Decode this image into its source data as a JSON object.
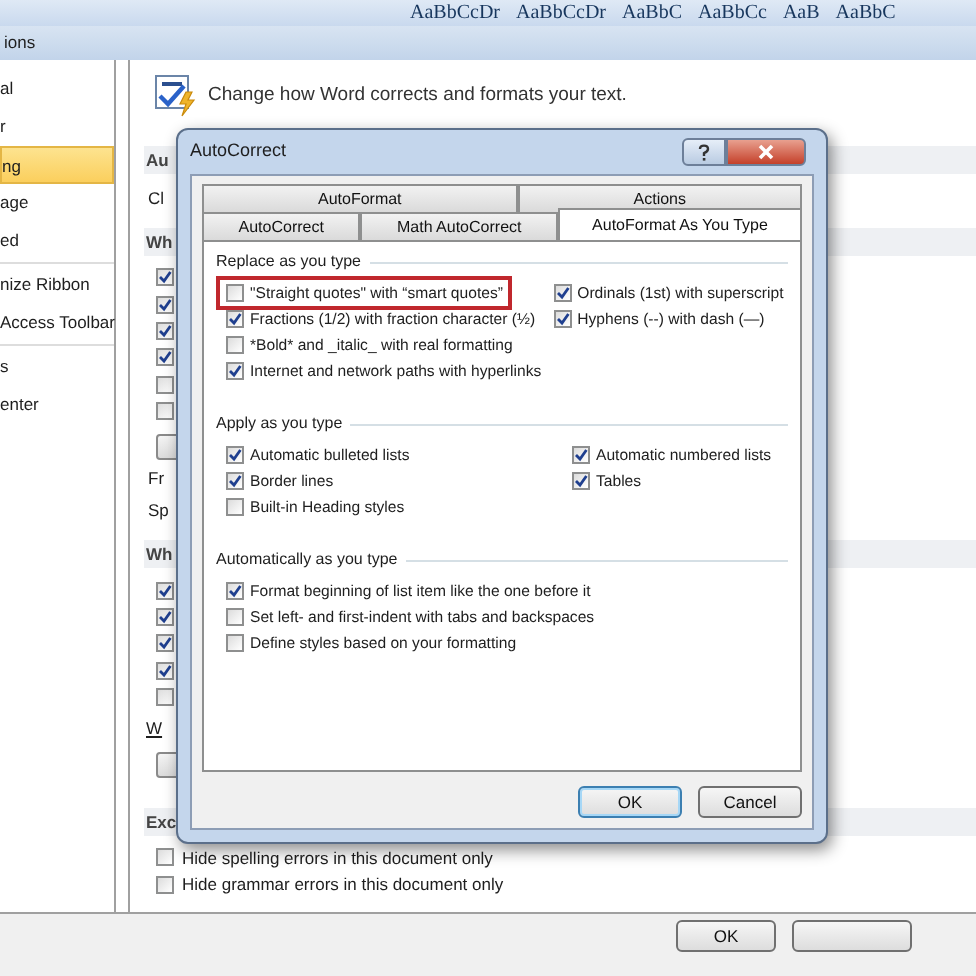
{
  "ribbon": {
    "style_samples": [
      "AaBbCcDr",
      "AaBbCcDr",
      "AaBbC",
      "AaBbCc",
      "AaB",
      "AaBbC"
    ]
  },
  "options_window": {
    "title": "ions",
    "sidebar": {
      "items": [
        {
          "label": "al",
          "selected": false
        },
        {
          "label": "r",
          "selected": false
        },
        {
          "label": "ng",
          "selected": true
        },
        {
          "label": "age",
          "selected": false
        },
        {
          "label": "ed",
          "selected": false
        },
        {
          "label": "nize Ribbon",
          "selected": false
        },
        {
          "label": "Access Toolbar",
          "selected": false
        },
        {
          "label": "s",
          "selected": false
        },
        {
          "label": "enter",
          "selected": false
        }
      ]
    },
    "heading": "Change how Word corrects and formats your text.",
    "content": [
      {
        "kind": "section",
        "label": "Au"
      },
      {
        "kind": "text",
        "label": "Cl"
      },
      {
        "kind": "section",
        "label": "Wh"
      },
      {
        "kind": "checkbox",
        "checked": true
      },
      {
        "kind": "checkbox",
        "checked": true
      },
      {
        "kind": "checkbox",
        "checked": true
      },
      {
        "kind": "checkbox",
        "checked": true
      },
      {
        "kind": "checkbox",
        "checked": false
      },
      {
        "kind": "checkbox",
        "checked": false
      },
      {
        "kind": "button"
      },
      {
        "kind": "text",
        "label": "Fr"
      },
      {
        "kind": "text",
        "label": "Sp"
      },
      {
        "kind": "section",
        "label": "Wh"
      },
      {
        "kind": "checkbox",
        "checked": true
      },
      {
        "kind": "checkbox",
        "checked": true
      },
      {
        "kind": "checkbox",
        "checked": true
      },
      {
        "kind": "checkbox",
        "checked": true
      },
      {
        "kind": "checkbox",
        "checked": false
      },
      {
        "kind": "link",
        "label": "W"
      },
      {
        "kind": "button"
      },
      {
        "kind": "section",
        "label": "Exc"
      },
      {
        "kind": "checkbox",
        "checked": false,
        "label": "Hide spelling errors in this document only"
      },
      {
        "kind": "checkbox",
        "checked": false,
        "label": "Hide grammar errors in this document only"
      }
    ],
    "buttons": [
      "OK"
    ]
  },
  "dialog": {
    "title": "AutoCorrect",
    "tab_rows": [
      [
        {
          "label": "AutoFormat",
          "selected": false
        },
        {
          "label": "Actions",
          "selected": false
        }
      ],
      [
        {
          "label": "AutoCorrect",
          "selected": false
        },
        {
          "label": "Math AutoCorrect",
          "selected": false
        },
        {
          "label": "AutoFormat As You Type",
          "selected": true
        }
      ]
    ],
    "groups": [
      {
        "title": "Replace as you type",
        "columns": [
          [
            {
              "label": "\"Straight quotes\" with “smart quotes”",
              "checked": false,
              "highlighted": true
            },
            {
              "label": "Fractions (1/2) with fraction character (½)",
              "checked": true
            },
            {
              "label": "*Bold* and _italic_ with real formatting",
              "checked": false
            },
            {
              "label": "Internet and network paths with hyperlinks",
              "checked": true
            }
          ],
          [
            {
              "label": "Ordinals (1st) with superscript",
              "checked": true
            },
            {
              "label": "Hyphens (--) with dash (—)",
              "checked": true
            }
          ]
        ]
      },
      {
        "title": "Apply as you type",
        "columns": [
          [
            {
              "label": "Automatic bulleted lists",
              "checked": true
            },
            {
              "label": "Border lines",
              "checked": true
            },
            {
              "label": "Built-in Heading styles",
              "checked": false
            }
          ],
          [
            {
              "label": "Automatic numbered lists",
              "checked": true
            },
            {
              "label": "Tables",
              "checked": true
            }
          ]
        ]
      },
      {
        "title": "Automatically as you type",
        "columns": [
          [
            {
              "label": "Format beginning of list item like the one before it",
              "checked": true
            },
            {
              "label": "Set left- and first-indent with tabs and backspaces",
              "checked": false
            },
            {
              "label": "Define styles based on your formatting",
              "checked": false
            }
          ]
        ]
      }
    ],
    "buttons": [
      {
        "label": "OK",
        "default": true
      },
      {
        "label": "Cancel",
        "default": false
      }
    ]
  }
}
